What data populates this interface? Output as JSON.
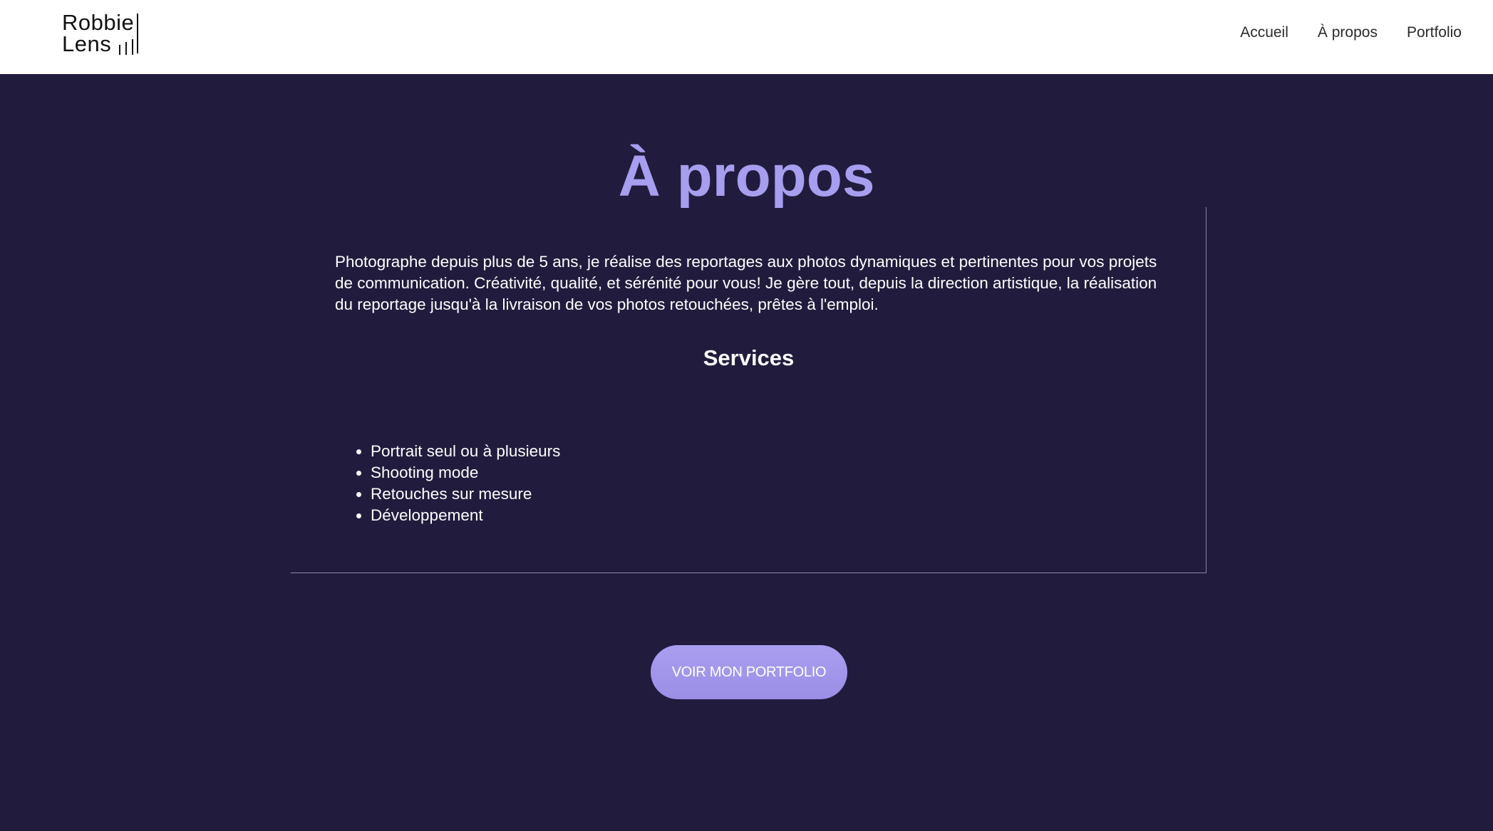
{
  "header": {
    "logo": {
      "line1": "Robbie",
      "line2": "Lens"
    },
    "nav": [
      {
        "label": "Accueil"
      },
      {
        "label": "À propos"
      },
      {
        "label": "Portfolio"
      }
    ]
  },
  "main": {
    "title": "À propos",
    "intro": "Photographe depuis plus de 5 ans, je réalise des reportages aux photos dynamiques et pertinentes pour vos projets de communication. Créativité, qualité, et sérénité pour vous! Je gère tout, depuis la direction artistique, la réalisation du reportage jusqu'à la livraison de vos photos retouchées, prêtes à l'emploi.",
    "services_title": "Services",
    "services": [
      "Portrait seul ou à plusieurs",
      "Shooting mode",
      "Retouches sur mesure",
      "Développement"
    ],
    "cta_label": "VOIR MON PORTFOLIO"
  },
  "colors": {
    "background": "#211c3d",
    "header_bg": "#ffffff",
    "accent": "#a79ef0",
    "text": "#ffffff"
  }
}
